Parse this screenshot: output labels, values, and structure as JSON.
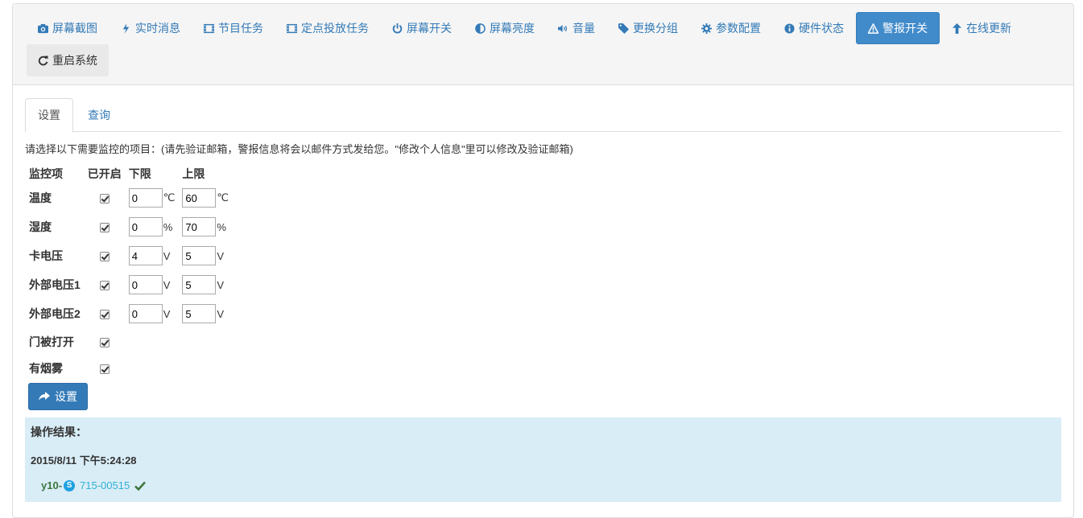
{
  "toolbar": {
    "buttons": [
      {
        "label": "屏幕截图",
        "icon": "camera-icon"
      },
      {
        "label": "实时消息",
        "icon": "bolt-icon"
      },
      {
        "label": "节目任务",
        "icon": "film-icon"
      },
      {
        "label": "定点投放任务",
        "icon": "film-icon"
      },
      {
        "label": "屏幕开关",
        "icon": "power-icon"
      },
      {
        "label": "屏幕亮度",
        "icon": "contrast-icon"
      },
      {
        "label": "音量",
        "icon": "volume-icon"
      },
      {
        "label": "更换分组",
        "icon": "tag-icon"
      },
      {
        "label": "参数配置",
        "icon": "gear-icon"
      },
      {
        "label": "硬件状态",
        "icon": "info-icon"
      },
      {
        "label": "警报开关",
        "icon": "warning-icon",
        "active": true
      },
      {
        "label": "在线更新",
        "icon": "arrow-up-icon"
      },
      {
        "label": "重启系统",
        "icon": "refresh-icon"
      }
    ]
  },
  "tabs": [
    {
      "label": "设置",
      "active": true
    },
    {
      "label": "查询",
      "active": false
    }
  ],
  "intro": "请选择以下需要监控的项目：(请先验证邮箱，警报信息将会以邮件方式发给您。\"修改个人信息\"里可以修改及验证邮箱)",
  "table": {
    "headers": [
      "监控项",
      "已开启",
      "下限",
      "上限"
    ],
    "rows": [
      {
        "label": "温度",
        "checked": true,
        "min": "0",
        "max": "60",
        "unit": "℃"
      },
      {
        "label": "湿度",
        "checked": true,
        "min": "0",
        "max": "70",
        "unit": "%"
      },
      {
        "label": "卡电压",
        "checked": true,
        "min": "4",
        "max": "5",
        "unit": "V"
      },
      {
        "label": "外部电压1",
        "checked": true,
        "min": "0",
        "max": "5",
        "unit": "V"
      },
      {
        "label": "外部电压2",
        "checked": true,
        "min": "0",
        "max": "5",
        "unit": "V"
      },
      {
        "label": "门被打开",
        "checked": true
      },
      {
        "label": "有烟雾",
        "checked": true
      }
    ]
  },
  "submit_label": "设置",
  "result": {
    "title": "操作结果：",
    "datetime": "2015/8/11 下午5:24:28",
    "device_prefix": "y10-",
    "device_code": "715-00515"
  },
  "colors": {
    "accent": "#337ab7",
    "active_button": "#428bca",
    "result_bg": "#d9edf7",
    "success": "#3c763d"
  }
}
